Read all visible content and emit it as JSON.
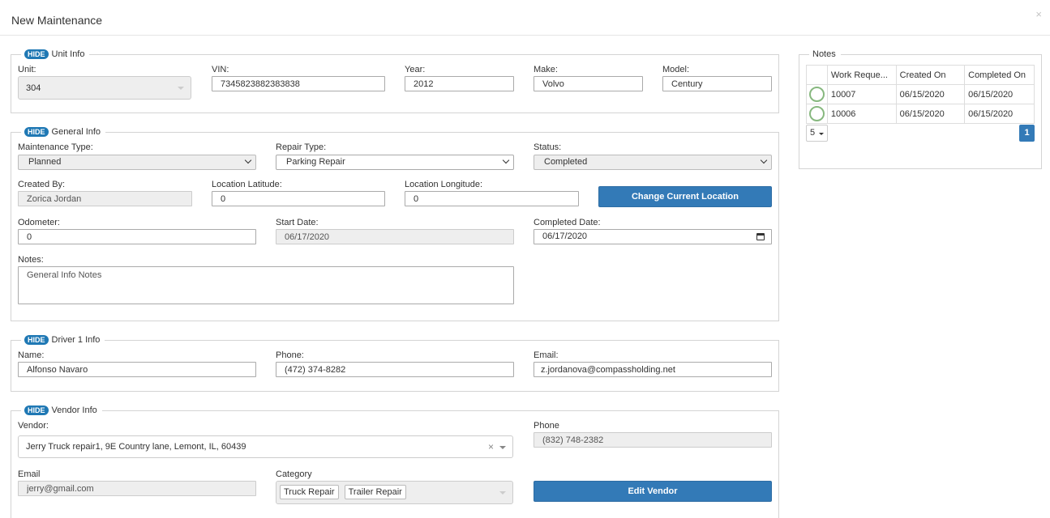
{
  "header": {
    "title": "New Maintenance",
    "close_label": "×"
  },
  "hide_label": "HIDE",
  "unit_info": {
    "legend": "Unit Info",
    "unit_label": "Unit:",
    "unit_value": "304",
    "vin_label": "VIN:",
    "vin_value": "7345823882383838",
    "year_label": "Year:",
    "year_value": "2012",
    "make_label": "Make:",
    "make_value": "Volvo",
    "model_label": "Model:",
    "model_value": "Century"
  },
  "general_info": {
    "legend": "General Info",
    "maintenance_type_label": "Maintenance Type:",
    "maintenance_type_value": "Planned",
    "repair_type_label": "Repair Type:",
    "repair_type_value": "Parking Repair",
    "status_label": "Status:",
    "status_value": "Completed",
    "created_by_label": "Created By:",
    "created_by_value": "Zorica Jordan",
    "latitude_label": "Location Latitude:",
    "latitude_value": "0",
    "longitude_label": "Location Longitude:",
    "longitude_value": "0",
    "change_location_label": "Change Current Location",
    "odometer_label": "Odometer:",
    "odometer_value": "0",
    "start_date_label": "Start Date:",
    "start_date_value": "06/17/2020",
    "completed_date_label": "Completed Date:",
    "completed_date_value": "06/17/2020",
    "notes_label": "Notes:",
    "notes_value": "General Info Notes"
  },
  "driver_info": {
    "legend": "Driver 1 Info",
    "name_label": "Name:",
    "name_value": "Alfonso Navaro",
    "phone_label": "Phone:",
    "phone_value": "(472) 374-8282",
    "email_label": "Email:",
    "email_value": "z.jordanova@compassholding.net"
  },
  "vendor_info": {
    "legend": "Vendor Info",
    "vendor_label": "Vendor:",
    "vendor_value": "Jerry Truck repair1, 9E Country lane, Lemont, IL, 60439",
    "phone_label": "Phone",
    "phone_value": "(832) 748-2382",
    "email_label": "Email",
    "email_value": "jerry@gmail.com",
    "category_label": "Category",
    "categories": [
      "Truck Repair",
      "Trailer Repair"
    ],
    "edit_vendor_label": "Edit Vendor"
  },
  "notes_panel": {
    "legend": "Notes",
    "columns": [
      "",
      "Work Reque...",
      "Created On",
      "Completed On"
    ],
    "rows": [
      {
        "work_request": "10007",
        "created_on": "06/15/2020",
        "completed_on": "06/15/2020"
      },
      {
        "work_request": "10006",
        "created_on": "06/15/2020",
        "completed_on": "06/15/2020"
      }
    ],
    "page_size": "5",
    "current_page": "1"
  }
}
